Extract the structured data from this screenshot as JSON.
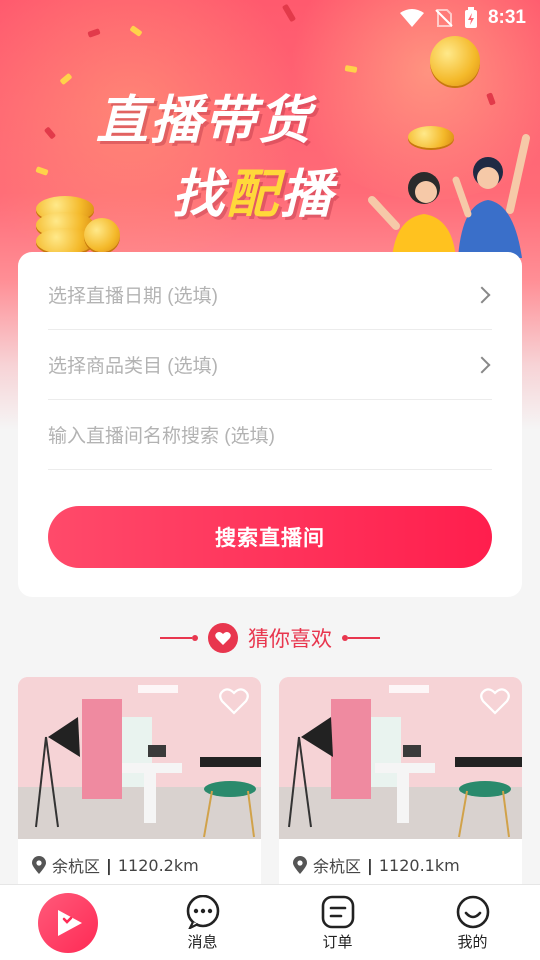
{
  "status_bar": {
    "time": "8:31"
  },
  "banner": {
    "title_line1": "直播带货",
    "title_line2_prefix": "找",
    "title_line2_highlight": "配",
    "title_line2_suffix": "播"
  },
  "search_form": {
    "date_field": "选择直播日期 (选填)",
    "category_field": "选择商品类目 (选填)",
    "name_field_placeholder": "输入直播间名称搜索 (选填)",
    "search_button": "搜索直播间"
  },
  "recommend": {
    "title": "猜你喜欢",
    "items": [
      {
        "district": "余杭区",
        "distance": "1120.2km"
      },
      {
        "district": "余杭区",
        "distance": "1120.1km"
      }
    ]
  },
  "tabbar": {
    "tabs": [
      {
        "label": "",
        "icon": "live-logo-icon"
      },
      {
        "label": "消息",
        "icon": "chat-bubble-icon"
      },
      {
        "label": "订单",
        "icon": "order-icon"
      },
      {
        "label": "我的",
        "icon": "smiley-icon"
      }
    ]
  },
  "colors": {
    "accent": "#ff2a55",
    "brand_red": "#e8364e",
    "highlight_yellow": "#ffd83a"
  }
}
